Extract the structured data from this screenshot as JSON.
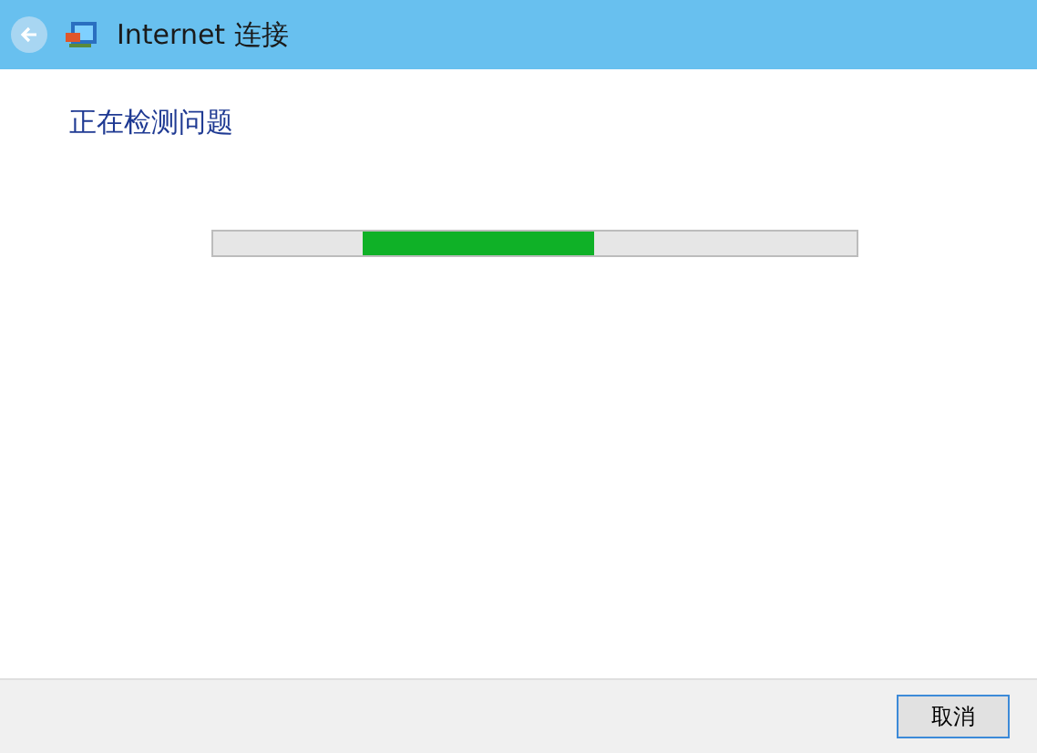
{
  "window": {
    "title": "Internet 连接",
    "back_button": {
      "disabled": true
    }
  },
  "heading": "正在检测问题",
  "progress": {
    "kind": "indeterminate"
  },
  "buttons": [
    {
      "label": "取消"
    }
  ]
}
